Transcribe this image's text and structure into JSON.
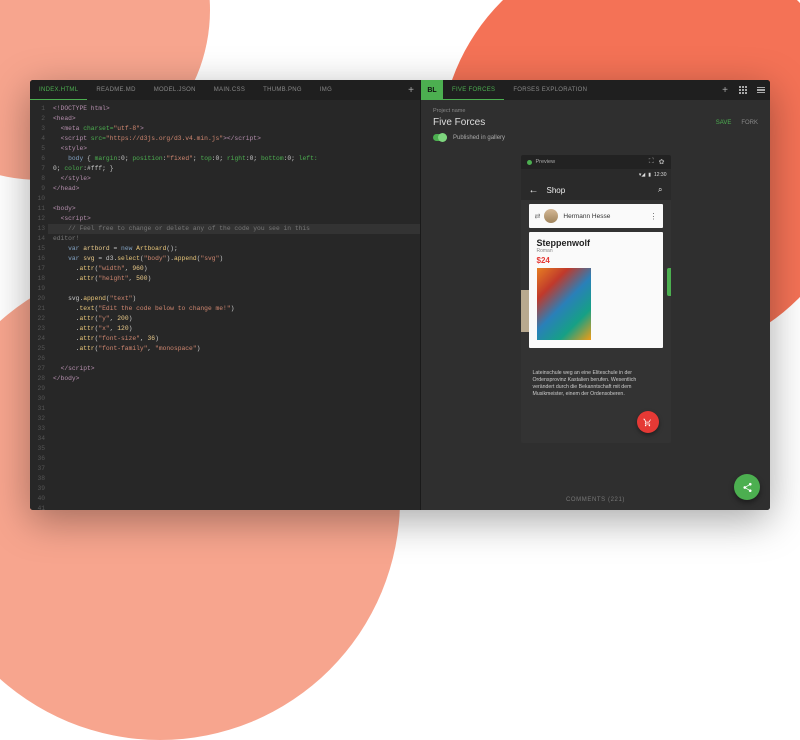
{
  "left_tabs": [
    "INDEX.HTML",
    "README.MD",
    "MODEL.JSON",
    "MAIN.CSS",
    "THUMB.PNG",
    "IMG"
  ],
  "left_active_tab": "INDEX.HTML",
  "logo": "BL",
  "right_tabs": [
    "FIVE FORCES",
    "FORSES EXPLORATION"
  ],
  "right_active_tab": "FIVE FORCES",
  "project": {
    "label": "Project name",
    "title": "Five Forces",
    "save": "SAVE",
    "fork": "FORK",
    "published": "Published in gallery"
  },
  "preview": {
    "label": "Preview",
    "status_time": "12:30",
    "app_title": "Shop",
    "author": "Hermann Hesse",
    "book_title": "Steppenwolf",
    "book_subtitle": "Roman",
    "book_price": "$24",
    "description": "Lateinschule weg an eine Eliteschule in der Ordensprovinz Kastalien berufen. Wesentlich verändert durch die Bekanntschaft mit dem Musikmeister, einem der Ordensoberen."
  },
  "comments": "COMMENTS (221)",
  "code": [
    {
      "html": "<span class='c-tag'>&lt;!DOCTYPE html&gt;</span>"
    },
    {
      "html": "<span class='c-tag'>&lt;head&gt;</span>"
    },
    {
      "html": "  <span class='c-tag'>&lt;meta</span> <span class='c-attr'>charset=</span><span class='c-str'>\"utf-8\"</span><span class='c-tag'>&gt;</span>"
    },
    {
      "html": "  <span class='c-tag'>&lt;script</span> <span class='c-attr'>src=</span><span class='c-str'>\"https://d3js.org/d3.v4.min.js\"</span><span class='c-tag'>&gt;&lt;/script&gt;</span>"
    },
    {
      "html": "  <span class='c-tag'>&lt;style&gt;</span>"
    },
    {
      "html": "    <span class='c-key'>body</span> { <span class='c-attr'>margin</span>:0; <span class='c-attr'>position</span>:<span class='c-str'>\"fixed\"</span>; <span class='c-attr'>top</span>:0; <span class='c-attr'>right</span>:0; <span class='c-attr'>bottom</span>:0; <span class='c-attr'>left:</span>"
    },
    {
      "html": "0; <span class='c-attr'>color</span>:#fff; }"
    },
    {
      "html": "  <span class='c-tag'>&lt;/style&gt;</span>"
    },
    {
      "html": "<span class='c-tag'>&lt;/head&gt;</span>"
    },
    {
      "html": ""
    },
    {
      "html": "<span class='c-tag'>&lt;body&gt;</span>"
    },
    {
      "html": "  <span class='c-tag'>&lt;script&gt;</span>"
    },
    {
      "html": "    <span class='c-cm'>// Feel free to change or delete any of the code you see in this</span>",
      "current": true
    },
    {
      "html": "<span class='c-cm'>editor!</span>"
    },
    {
      "html": "    <span class='c-key'>var</span> <span class='c-var'>artbord</span> = <span class='c-key'>new</span> <span class='c-js'>Artboard</span>();"
    },
    {
      "html": "    <span class='c-key'>var</span> <span class='c-var'>svg</span> = d3.<span class='c-js'>select</span>(<span class='c-str'>\"body\"</span>).<span class='c-js'>append</span>(<span class='c-str'>\"svg\"</span>)"
    },
    {
      "html": "      .<span class='c-js'>attr</span>(<span class='c-str'>\"width\"</span>, <span class='c-var'>960</span>)"
    },
    {
      "html": "      .<span class='c-js'>attr</span>(<span class='c-str'>\"height\"</span>, <span class='c-var'>500</span>)"
    },
    {
      "html": ""
    },
    {
      "html": "    svg.<span class='c-js'>append</span>(<span class='c-str'>\"text\"</span>)"
    },
    {
      "html": "      .<span class='c-js'>text</span>(<span class='c-str'>\"Edit the code below to change me!\"</span>)"
    },
    {
      "html": "      .<span class='c-js'>attr</span>(<span class='c-str'>\"y\"</span>, <span class='c-var'>200</span>)"
    },
    {
      "html": "      .<span class='c-js'>attr</span>(<span class='c-str'>\"x\"</span>, <span class='c-var'>120</span>)"
    },
    {
      "html": "      .<span class='c-js'>attr</span>(<span class='c-str'>\"font-size\"</span>, <span class='c-var'>36</span>)"
    },
    {
      "html": "      .<span class='c-js'>attr</span>(<span class='c-str'>\"font-family\"</span>, <span class='c-str'>\"monospace\"</span>)"
    },
    {
      "html": ""
    },
    {
      "html": "  <span class='c-tag'>&lt;/script&gt;</span>"
    },
    {
      "html": "<span class='c-tag'>&lt;/body&gt;</span>"
    }
  ]
}
